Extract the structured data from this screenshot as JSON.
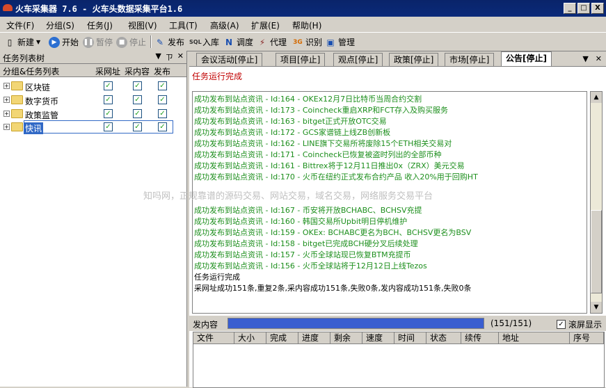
{
  "window": {
    "title": "火车采集器 7.6 - 火车头数据采集平台1.6",
    "controls": [
      "_",
      "□",
      "X"
    ]
  },
  "menu": [
    "文件(F)",
    "分组(S)",
    "任务(J)",
    "视图(V)",
    "工具(T)",
    "高级(A)",
    "扩展(E)",
    "帮助(H)"
  ],
  "toolbar": {
    "new": "新建",
    "start": "开始",
    "pause": "暂停",
    "stop": "停止",
    "publish": "发布",
    "import": "入库",
    "debug": "调度",
    "proxy": "代理",
    "recognize": "识别",
    "manage": "管理"
  },
  "left_panel": {
    "title": "任务列表树",
    "btns": [
      "▼",
      "ㄗ",
      "✕"
    ],
    "col_group": "分组&任务列表",
    "col_url": "采网址",
    "col_content": "采内容",
    "col_publish": "发布",
    "rows": [
      {
        "label": "区块链"
      },
      {
        "label": "数字货币"
      },
      {
        "label": "政策监管"
      },
      {
        "label": "快讯"
      }
    ]
  },
  "tabs": [
    "会议活动[停止]",
    "项目[停止]",
    "观点[停止]",
    "政策[停止]",
    "市场[停止]",
    "公告[停止]"
  ],
  "tab_controls": [
    "▼",
    "✕"
  ],
  "status_top": "任务运行完成",
  "log": [
    "成功发布到站点资讯 - Id:164 - OKEx12月7日比特币当周合约交割",
    "成功发布到站点资讯 - Id:173 - Coincheck重启XRP和FCT存入及购买服务",
    "成功发布到站点资讯 - Id:163 - bitget正式开放OTC交易",
    "成功发布到站点资讯 - Id:172 - GCS家谱链上线ZB创新板",
    "成功发布到站点资讯 - Id:162 - LINE旗下交易所将废除15个ETH相关交易对",
    "成功发布到站点资讯 - Id:171 - Coincheck已恢复被盗时列出的全部币种",
    "成功发布到站点资讯 - Id:161 - Bittrex将于12月11日推出0x（ZRX）美元交易",
    "成功发布到站点资讯 - Id:170 - 火币在纽约正式发布合约产品 收入20%用于回购HT",
    "成功发布到站点资讯 - Id:167 - 币安将开放BCHABC、BCHSV充提",
    "成功发布到站点资讯 - Id:160 - 韩国交易所Upbit明日停机维护",
    "成功发布到站点资讯 - Id:159 - OKEx: BCHABC更名为BCH、BCHSV更名为BSV",
    "成功发布到站点资讯 - Id:158 - bitget已完成BCH硬分叉后续处理",
    "成功发布到站点资讯 - Id:157 - 火币全球站现已恢复BTM充提币",
    "成功发布到站点资讯 - Id:156 - 火币全球站将于12月12日上线Tezos"
  ],
  "log_tail": [
    "任务运行完成",
    "采网址成功151条,重复2条,采内容成功151条,失败0条,发内容成功151条,失败0条"
  ],
  "watermark": "知吗网，正规靠谱的源码交易、网站交易，域名交易，网络服务交易平台",
  "progress": {
    "label": "发内容",
    "count": "(151/151)",
    "fraction": 1.0,
    "fullscreen_label": "滚屏显示"
  },
  "grid_columns": [
    "文件",
    "大小",
    "完成",
    "进度",
    "剩余",
    "速度",
    "时间",
    "状态",
    "续传",
    "地址",
    "序号"
  ],
  "colors": {
    "title_bar": "#0a246a",
    "log_green": "#1d8f1d",
    "status_red": "#c00000",
    "progress_fill": "#3a5ed0"
  }
}
